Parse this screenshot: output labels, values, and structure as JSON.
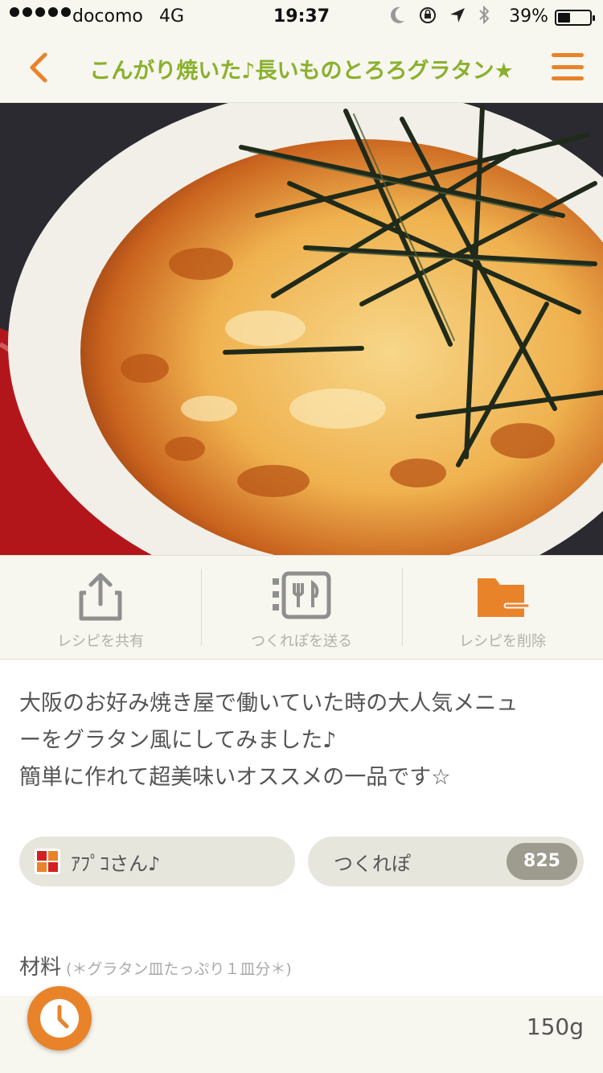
{
  "status_bar": {
    "carrier": "docomo",
    "network": "4G",
    "time": "19:37",
    "battery": "39%",
    "battery_level": 0.39,
    "icons": [
      "moon-icon",
      "rotation-lock-icon",
      "location-icon",
      "bluetooth-icon"
    ]
  },
  "nav": {
    "title": "こんがり焼いた♪長いものとろろグラタン★",
    "back_icon": "chevron-left-icon",
    "menu_icon": "hamburger-icon"
  },
  "hero": {
    "image": "gratin-photo"
  },
  "actions": [
    {
      "label": "レシピを共有",
      "icon": "share-icon"
    },
    {
      "label": "つくれぽを送る",
      "icon": "tsukurepo-icon"
    },
    {
      "label": "レシピを削除",
      "icon": "folder-delete-icon"
    }
  ],
  "description": [
    "大阪のお好み焼き屋で働いていた時の大人気メニュ",
    "ーをグラタン風にしてみました♪",
    "簡単に作れて超美味いオススメの一品です☆"
  ],
  "author": {
    "name": "ｱﾌﾟｺさん♪"
  },
  "tsukurepo": {
    "label": "つくれぽ",
    "count": "825"
  },
  "ingredients": {
    "title": "材料",
    "note": "(＊グラタン皿たっぷり１皿分＊)",
    "first_item_amount": "150g"
  },
  "colors": {
    "accent": "#e8832a",
    "title_green": "#8ab02d",
    "bar_bg": "#f7f6ef"
  }
}
